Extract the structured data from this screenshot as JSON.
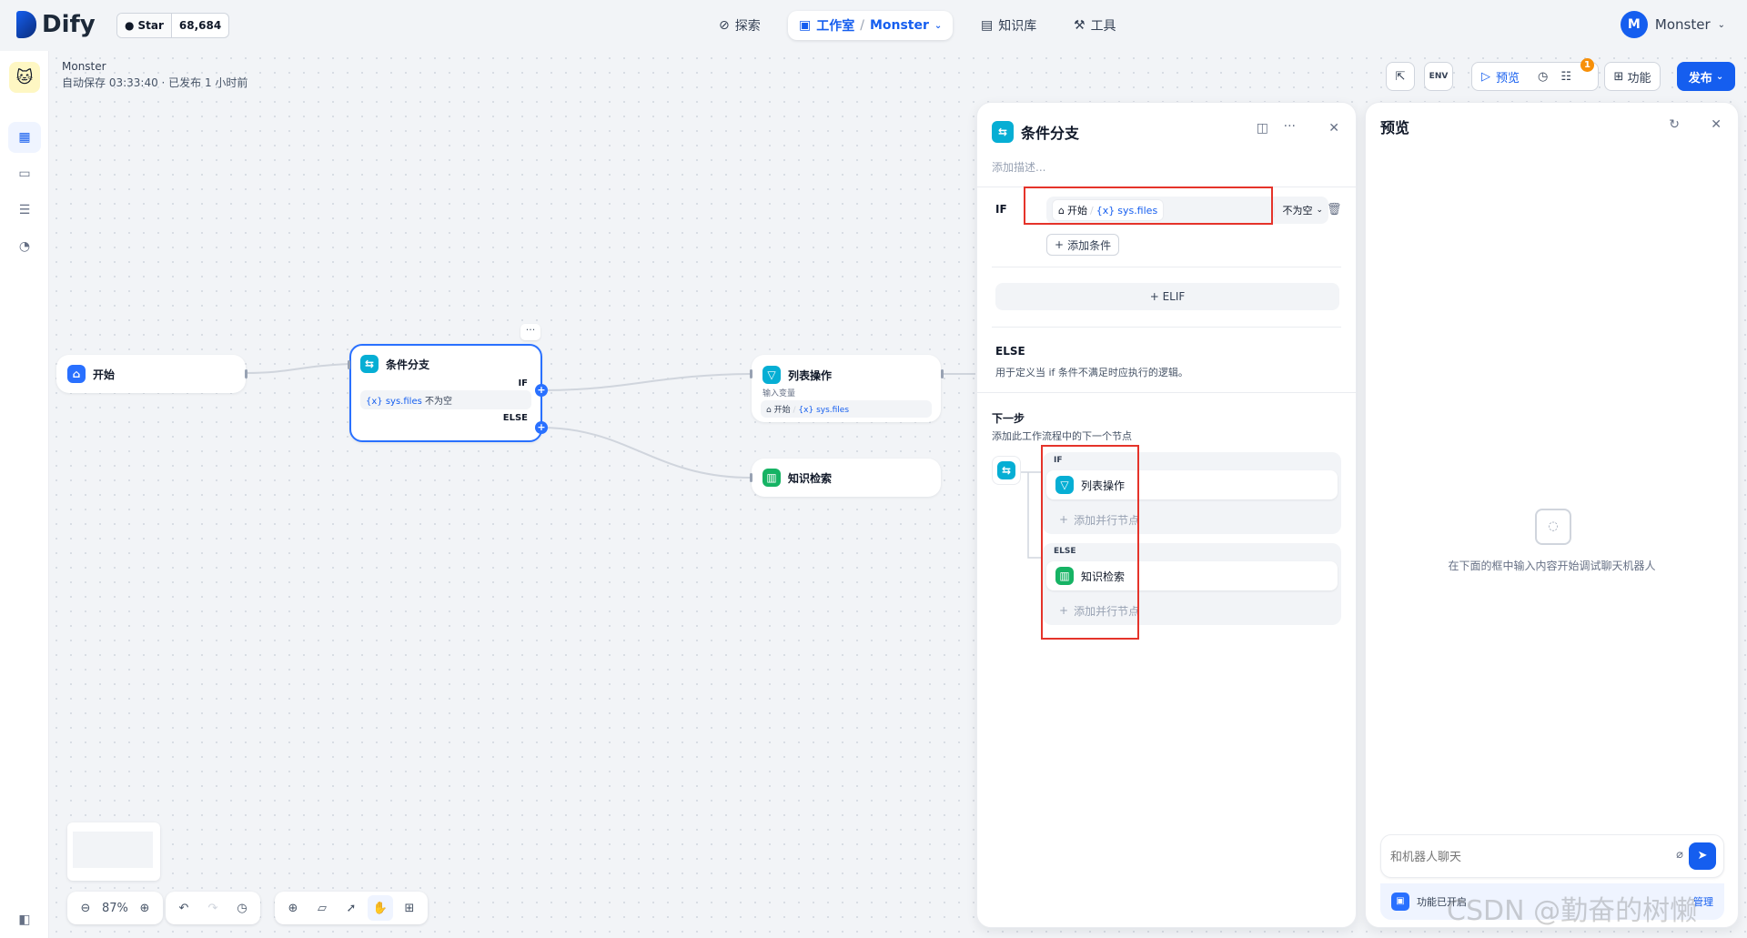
{
  "brand": {
    "name": "Dify"
  },
  "github": {
    "label": "Star",
    "count": "68,684"
  },
  "nav": {
    "explore": "探索",
    "studio": "工作室",
    "app_name": "Monster",
    "knowledge": "知识库",
    "tools": "工具"
  },
  "user": {
    "initial": "M",
    "name": "Monster"
  },
  "app": {
    "name": "Monster",
    "status": "自动保存 03:33:40 · 已发布 1 小时前"
  },
  "toolbar": {
    "env": "ENV",
    "preview": "预览",
    "features": "功能",
    "publish": "发布",
    "badge": "1"
  },
  "nodes": {
    "start": {
      "title": "开始"
    },
    "ifelse": {
      "title": "条件分支",
      "if_label": "IF",
      "else_label": "ELSE",
      "cond_var": "sys.files",
      "cond_op": "不为空",
      "var_prefix": "{x}"
    },
    "list": {
      "title": "列表操作",
      "input_label": "输入变量",
      "src": "开始",
      "var": "sys.files"
    },
    "knowledge": {
      "title": "知识检索"
    }
  },
  "panel": {
    "title": "条件分支",
    "desc_placeholder": "添加描述...",
    "if_label": "IF",
    "cond_src": "开始",
    "cond_var": "sys.files",
    "cond_op": "不为空",
    "add_condition": "添加条件",
    "elif": "+ ELIF",
    "else_title": "ELSE",
    "else_desc": "用于定义当 if 条件不满足时应执行的逻辑。",
    "next_title": "下一步",
    "next_desc": "添加此工作流程中的下一个节点",
    "branch_if": "IF",
    "branch_if_node": "列表操作",
    "branch_else": "ELSE",
    "branch_else_node": "知识检索",
    "add_parallel": "添加并行节点"
  },
  "preview": {
    "title": "预览",
    "empty_text": "在下面的框中输入内容开始调试聊天机器人",
    "input_placeholder": "和机器人聊天",
    "features_enabled": "功能已开启",
    "manage": "管理"
  },
  "controls": {
    "zoom": "87%"
  },
  "watermark": "CSDN @勤奋的树懒"
}
